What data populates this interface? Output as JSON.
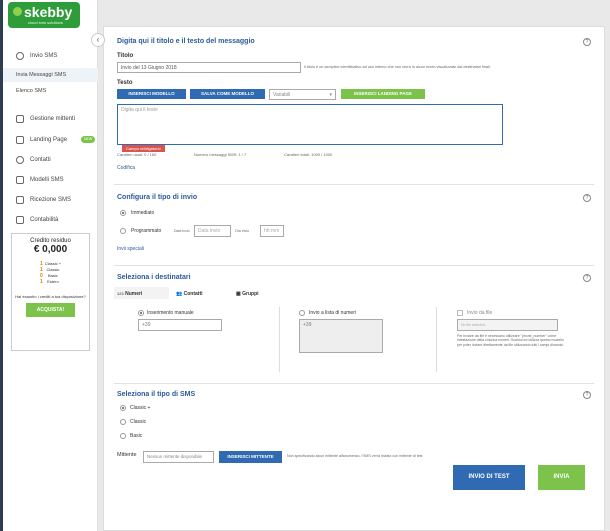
{
  "brand": {
    "name": "skebby",
    "tagline": "cloud sms solutions"
  },
  "sidebar": {
    "items": [
      {
        "label": "Invio SMS",
        "icon": "chat-icon"
      },
      {
        "label": "Gestione mittenti",
        "icon": "list-icon"
      },
      {
        "label": "Landing Page",
        "icon": "page-icon",
        "badge": "NEW"
      },
      {
        "label": "Contatti",
        "icon": "user-icon"
      },
      {
        "label": "Modelli SMS",
        "icon": "bookmark-icon"
      },
      {
        "label": "Ricezione SMS",
        "icon": "inbox-icon"
      },
      {
        "label": "Contabilità",
        "icon": "calculator-icon"
      }
    ],
    "sub": [
      "Invia Messaggi SMS",
      "Elenco SMS"
    ]
  },
  "credit": {
    "title": "Credito residuo",
    "value": "€ 0,000",
    "rows": [
      {
        "n": "1",
        "t": "Classic +"
      },
      {
        "n": "1",
        "t": "Classic"
      },
      {
        "n": "0",
        "t": "Basic"
      },
      {
        "n": "1",
        "t": "Estero"
      }
    ],
    "note": "Hai esaurito i crediti a tua disposizione?",
    "buy": "ACQUISTA!"
  },
  "section1": {
    "title": "Digita qui il titolo e il testo del messaggio",
    "titolo_label": "Titolo",
    "titolo_value": "Invio del 13 Giugno 2018",
    "titolo_help": "Il titolo è un semplice identificativo ad uso interno che non verrà in alcun modo visualizzato dai destinatari finali.",
    "testo_label": "Testo",
    "btn_modello": "INSERISCI MODELLO",
    "btn_salva": "SALVA COME MODELLO",
    "variabili": "Variabili",
    "btn_landing": "INSERISCI LANDING PAGE",
    "testo_placeholder": "Digita qui il testo",
    "warn": "Campo obbligatorio",
    "caratteri": "Caratteri usati: 0 / 160",
    "numero_sms": "Numero messaggi SMS: 1 / 7",
    "caratteri_tot": "Caratteri totali: 1000 / 1000",
    "codifica": "Codifica"
  },
  "section2": {
    "title": "Configura il tipo di invio",
    "immediato": "Immediato",
    "programmato": "Programmato",
    "data_label": "Data invio",
    "data_ph": "Data invio",
    "ora_label": "Ora invio",
    "ora_ph": "hh:mm",
    "speciali": "Invii speciali"
  },
  "section3": {
    "title": "Seleziona i destinatari",
    "tabs": [
      "Numeri",
      "Contatti",
      "Gruppi"
    ],
    "manuale": "Inserimento manuale",
    "manuale_ph": "+39",
    "lista": "Invio a lista di numeri",
    "lista_ph": "+39",
    "file": "Invio da file",
    "file_ph": "No file selected.",
    "file_note": "Per inviare da file è necessario utilizzare \"phone_number\" come intestazione della colonna numeri. Scarica ed utilizza questo modello per poter inviare direttamente da file utilizzando tutti i campi dinamici."
  },
  "section4": {
    "title": "Seleziona il tipo di SMS",
    "types": [
      "Classic +",
      "Classic",
      "Basic"
    ],
    "mittente_label": "Mittente",
    "mittente_ph": "Nessun mittente disponibile",
    "btn_mittente": "INSERISCI MITTENTE",
    "mittente_note": "Non specificando alcun mittente alfanumerico, l'SMS verrà inviato con mittente di test",
    "btn_test": "INVIO DI TEST",
    "btn_invia": "INVIA"
  }
}
